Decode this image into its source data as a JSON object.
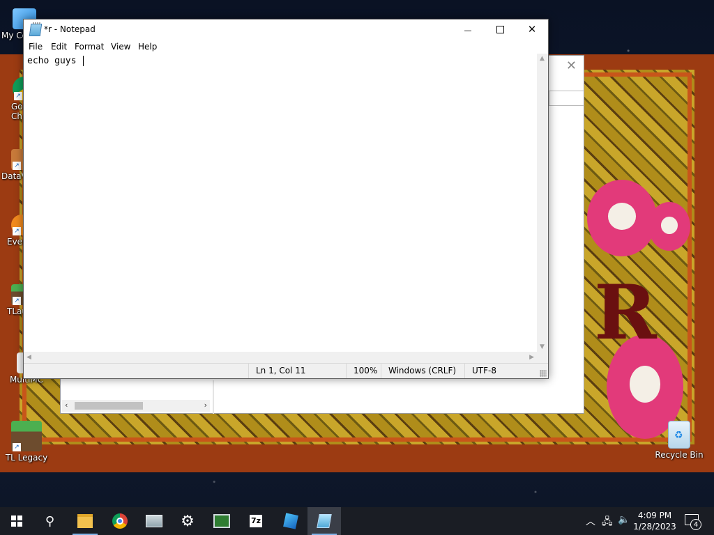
{
  "desktop": {
    "wallpaper_letter": "R",
    "icons": [
      {
        "label": "My Co",
        "icon": "monitor-icon"
      },
      {
        "label": "Go\nCh",
        "icon": "chrome-icon"
      },
      {
        "label": "DataV",
        "icon": "app-icon"
      },
      {
        "label": "Ever",
        "icon": "app-icon"
      },
      {
        "label": "TLau",
        "icon": "minecraft-icon"
      },
      {
        "label": "MultiMC",
        "icon": "app-icon"
      },
      {
        "label": "TL Legacy",
        "icon": "minecraft-icon"
      },
      {
        "label": "Recycle Bin",
        "icon": "recycle-bin-icon"
      }
    ]
  },
  "notepad": {
    "title": "*r - Notepad",
    "controls": {
      "minimize": "—",
      "close": "✕"
    },
    "menu": [
      "File",
      "Edit",
      "Format",
      "View",
      "Help"
    ],
    "text": "echo guys ",
    "status": {
      "position": "Ln 1, Col 11",
      "zoom": "100%",
      "line_endings": "Windows (CRLF)",
      "encoding": "UTF-8"
    }
  },
  "background_window": {
    "close": "✕"
  },
  "taskbar": {
    "apps": [
      "search-icon",
      "file-explorer-icon",
      "chrome-icon",
      "pc-icon",
      "settings-icon",
      "terminal-icon",
      "7zip-icon",
      "app-icon",
      "notepad-icon"
    ],
    "sevenzip_label": "7z",
    "time": "4:09 PM",
    "date": "1/28/2023",
    "notification_count": "4"
  },
  "colors": {
    "taskbar": "#1a1d24",
    "running_indicator": "#7fb2e6",
    "wallpaper_border": "#9c3b12",
    "flower": "#e23a7a"
  }
}
